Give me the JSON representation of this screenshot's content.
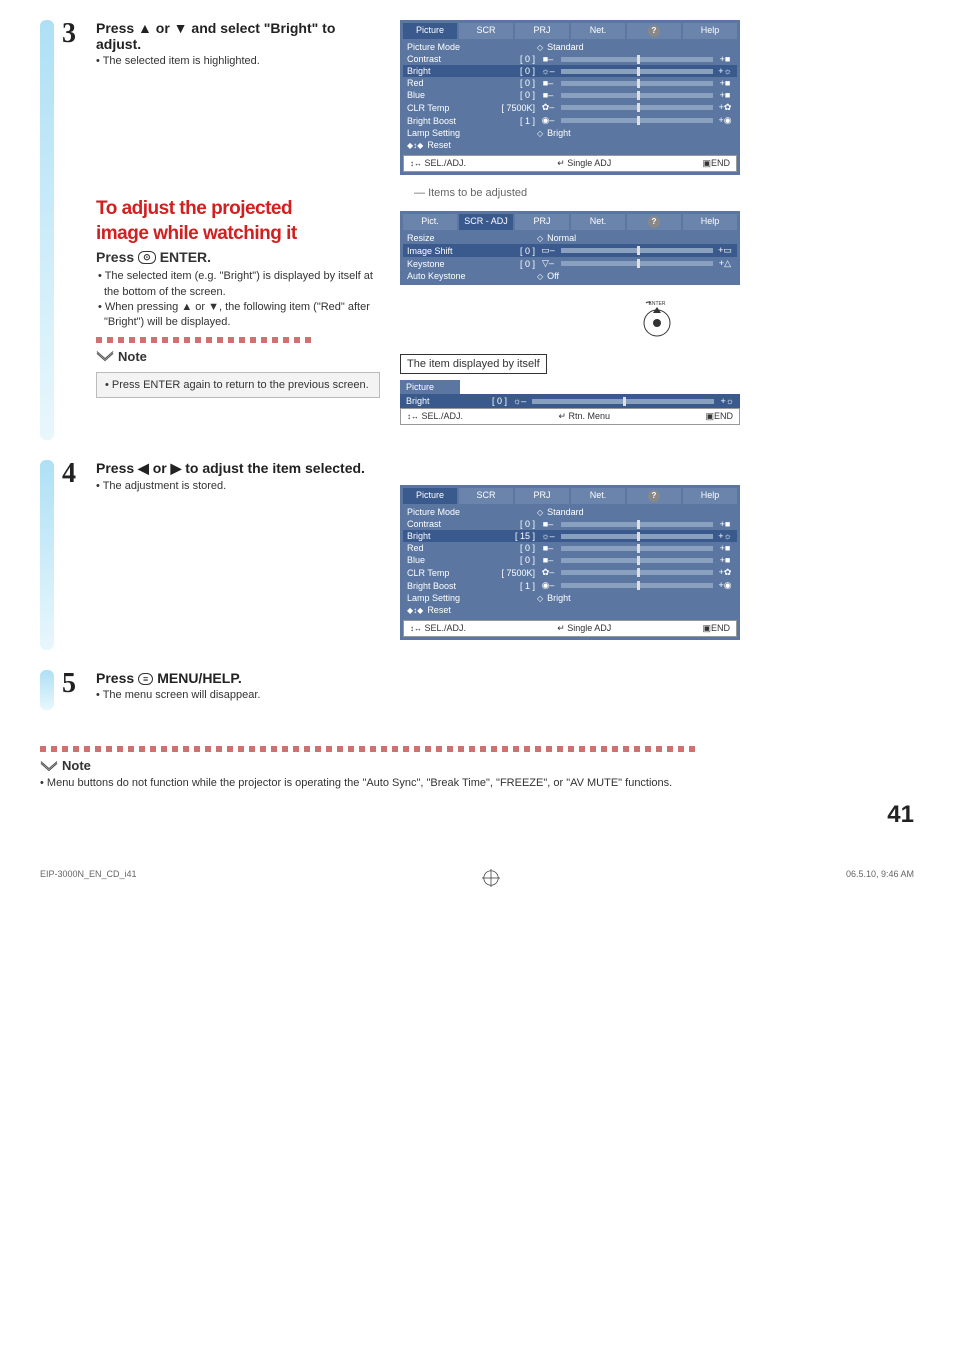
{
  "step3": {
    "num": "3",
    "heading_a": "Press ▲ or ▼ and select \"Bright\" to adjust.",
    "bullet": "• The selected item is highlighted."
  },
  "redSection": {
    "title_l1": "To adjust the projected",
    "title_l2": "image while watching it",
    "sub": "ENTER.",
    "sub_prefix": "Press ",
    "b1": "• The selected item (e.g. \"Bright\") is displayed by itself at the bottom of the screen.",
    "b2": "• When pressing ▲ or ▼, the following item (\"Red\" after \"Bright\") will be displayed."
  },
  "note1": {
    "label": "Note",
    "text": "• Press       ENTER again to return to the previous screen."
  },
  "step4": {
    "num": "4",
    "heading": "Press ◀ or ▶ to adjust the item selected.",
    "bullet": "• The adjustment is stored."
  },
  "step5": {
    "num": "5",
    "heading": "Press      MENU/HELP.",
    "heading_pre": "Press ",
    "heading_post": " MENU/HELP.",
    "bullet": "• The menu screen will disappear."
  },
  "note2": {
    "label": "Note",
    "text": "• Menu buttons do not function while the projector is operating the \"Auto Sync\", \"Break Time\", \"FREEZE\", or \"AV MUTE\" functions."
  },
  "osd1": {
    "tabs": [
      "Picture",
      "SCR",
      "PRJ",
      "Net.",
      "?",
      "Help"
    ],
    "rows": [
      {
        "label": "Picture Mode",
        "value": "",
        "mid": "Standard"
      },
      {
        "label": "Contrast",
        "value": "[    0 ]",
        "iconL": "■–",
        "bar": true,
        "iconR": "+■"
      },
      {
        "label": "Bright",
        "value": "[    0 ]",
        "iconL": "☼–",
        "bar": true,
        "iconR": "+☼",
        "selected": true
      },
      {
        "label": "Red",
        "value": "[    0 ]",
        "iconL": "■–",
        "bar": true,
        "iconR": "+■"
      },
      {
        "label": "Blue",
        "value": "[    0 ]",
        "iconL": "■–",
        "bar": true,
        "iconR": "+■"
      },
      {
        "label": "CLR Temp",
        "value": "[ 7500K]",
        "iconL": "✿–",
        "bar": true,
        "iconR": "+✿"
      },
      {
        "label": "Bright Boost",
        "value": "[    1 ]",
        "iconL": "◉–",
        "bar": true,
        "iconR": "+◉"
      },
      {
        "label": "Lamp Setting",
        "value": "",
        "mid": "Bright"
      }
    ],
    "reset": "Reset",
    "bottom": {
      "left": "SEL./ADJ.",
      "mid": "↵ Single ADJ",
      "right": "END"
    }
  },
  "caption1": "Items to be adjusted",
  "osd2": {
    "tabs": [
      "Pict.",
      "SCR - ADJ",
      "PRJ",
      "Net.",
      "?",
      "Help"
    ],
    "rows": [
      {
        "label": "Resize",
        "value": "",
        "mid": "Normal"
      },
      {
        "label": "Image Shift",
        "value": "[    0 ]",
        "iconL": "▭–",
        "bar": true,
        "iconR": "+▭",
        "selected": true
      },
      {
        "label": "Keystone",
        "value": "[    0 ]",
        "iconL": "▽–",
        "bar": true,
        "iconR": "+△"
      },
      {
        "label": "Auto Keystone",
        "value": "",
        "mid": "Off"
      }
    ]
  },
  "itemBox": "The item displayed by itself",
  "single": {
    "title": "Picture",
    "row": {
      "label": "Bright",
      "value": "[    0 ]",
      "iconL": "☼–",
      "iconR": "+☼"
    },
    "bottom": {
      "left": "SEL./ADJ.",
      "mid": "↵ Rtn. Menu",
      "right": "END"
    }
  },
  "osd3": {
    "tabs": [
      "Picture",
      "SCR",
      "PRJ",
      "Net.",
      "?",
      "Help"
    ],
    "rows": [
      {
        "label": "Picture Mode",
        "value": "",
        "mid": "Standard"
      },
      {
        "label": "Contrast",
        "value": "[    0 ]",
        "iconL": "■–",
        "bar": true,
        "iconR": "+■"
      },
      {
        "label": "Bright",
        "value": "[  15 ]",
        "iconL": "☼–",
        "bar": true,
        "iconR": "+☼",
        "selected": true
      },
      {
        "label": "Red",
        "value": "[    0 ]",
        "iconL": "■–",
        "bar": true,
        "iconR": "+■"
      },
      {
        "label": "Blue",
        "value": "[    0 ]",
        "iconL": "■–",
        "bar": true,
        "iconR": "+■"
      },
      {
        "label": "CLR Temp",
        "value": "[ 7500K]",
        "iconL": "✿–",
        "bar": true,
        "iconR": "+✿"
      },
      {
        "label": "Bright Boost",
        "value": "[    1 ]",
        "iconL": "◉–",
        "bar": true,
        "iconR": "+◉"
      },
      {
        "label": "Lamp Setting",
        "value": "",
        "mid": "Bright"
      }
    ],
    "reset": "Reset",
    "bottom": {
      "left": "SEL./ADJ.",
      "mid": "↵ Single ADJ",
      "right": "END"
    }
  },
  "pageNum": "41",
  "footer": {
    "left": "EIP-3000N_EN_CD_i",
    "mid": "41",
    "right": "06.5.10, 9:46 AM"
  }
}
